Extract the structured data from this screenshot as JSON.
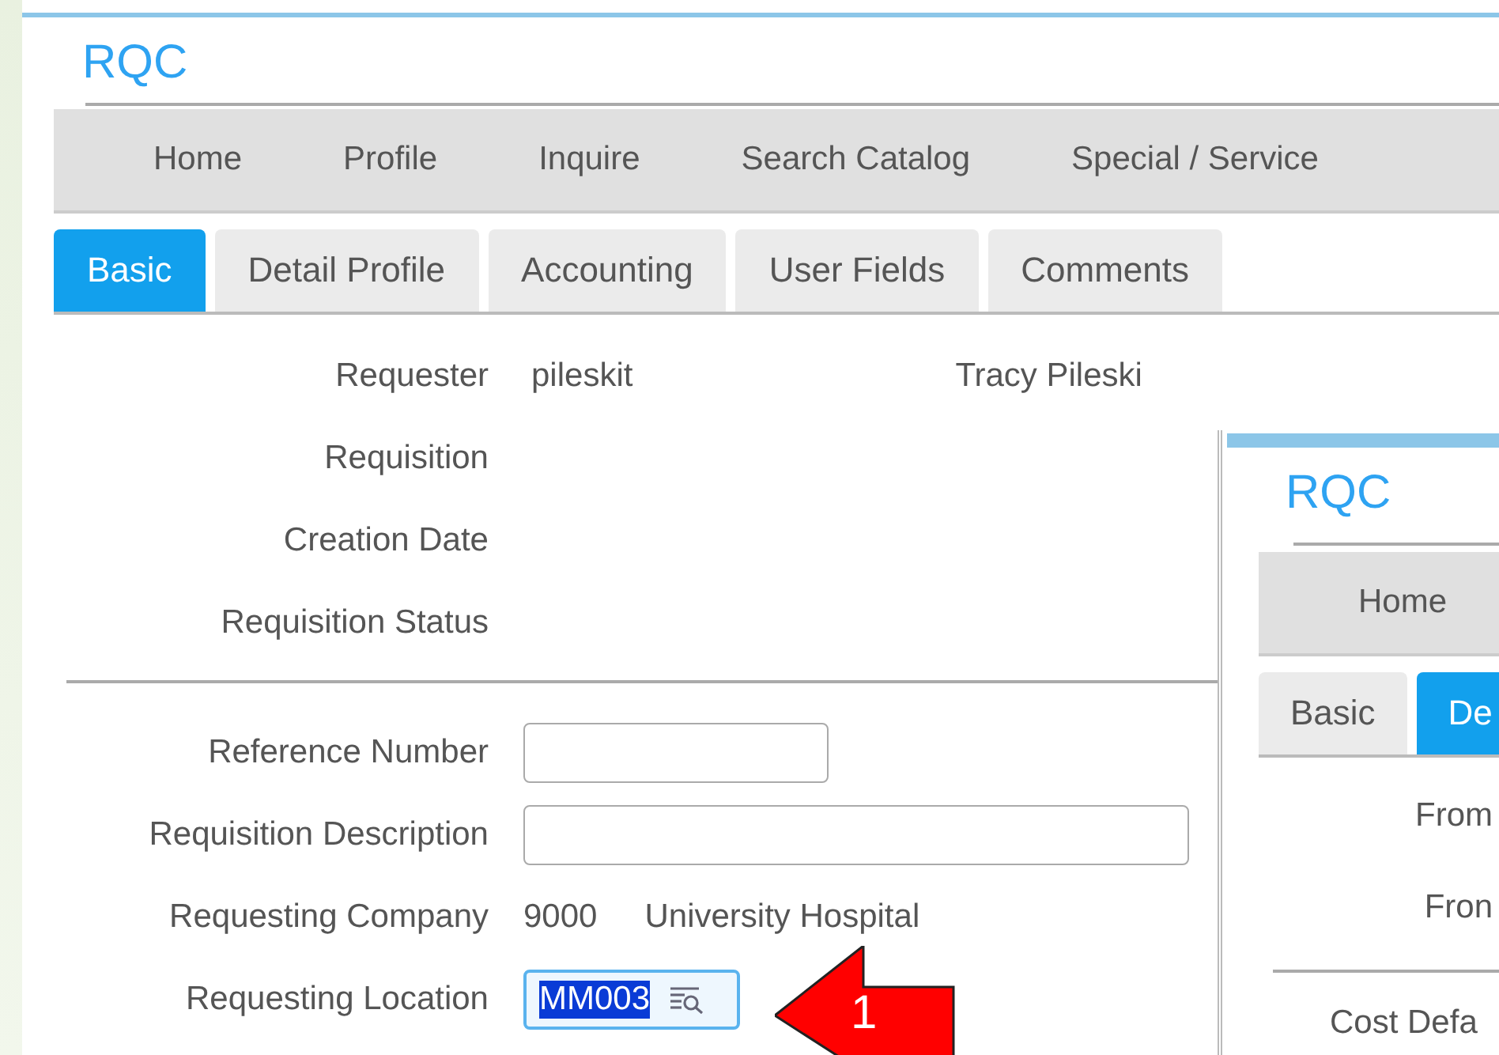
{
  "main_window": {
    "title": "RQC",
    "nav": [
      "Home",
      "Profile",
      "Inquire",
      "Search Catalog",
      "Special / Service"
    ],
    "tabs": [
      {
        "label": "Basic",
        "selected": true
      },
      {
        "label": "Detail Profile",
        "selected": false
      },
      {
        "label": "Accounting",
        "selected": false
      },
      {
        "label": "User Fields",
        "selected": false
      },
      {
        "label": "Comments",
        "selected": false
      }
    ],
    "header_rows": [
      {
        "label": "Requester",
        "values": [
          "pileskit",
          "Tracy Pileski"
        ]
      },
      {
        "label": "Requisition"
      },
      {
        "label": "Creation Date"
      },
      {
        "label": "Requisition Status"
      }
    ],
    "form_rows": [
      {
        "kind": "short_input",
        "label": "Reference Number"
      },
      {
        "kind": "long_input",
        "label": "Requisition Description"
      },
      {
        "kind": "text",
        "label": "Requesting Company",
        "values": [
          "9000",
          "University Hospital"
        ]
      },
      {
        "kind": "lookup",
        "label": "Requesting Location",
        "value": "MM003",
        "highlighted": true
      }
    ]
  },
  "second_window": {
    "title": "RQC",
    "nav": [
      "Home"
    ],
    "tabs": [
      {
        "label": "Basic",
        "selected": false
      },
      {
        "label": "De",
        "selected": true
      }
    ],
    "rows": [
      {
        "label": "From"
      },
      {
        "label": "Fron"
      }
    ],
    "footer_label": "Cost Defa"
  },
  "callout": {
    "number": "1"
  }
}
